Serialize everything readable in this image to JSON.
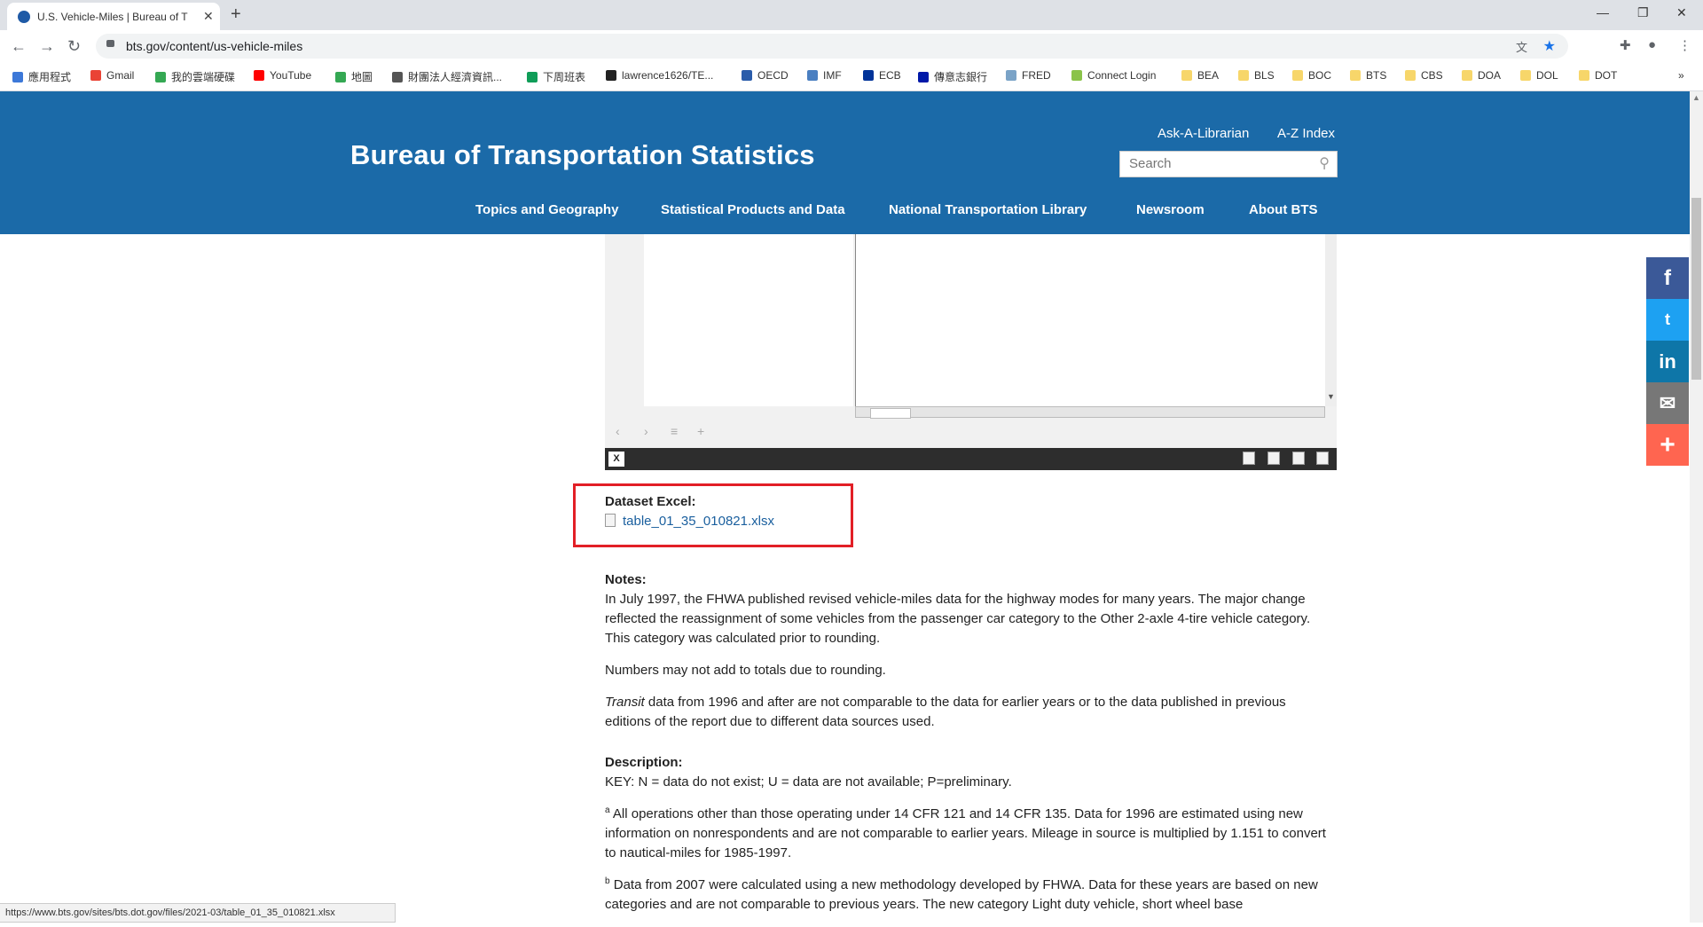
{
  "browser": {
    "tab_title": "U.S. Vehicle-Miles | Bureau of T",
    "url": "bts.gov/content/us-vehicle-miles",
    "bookmarks": [
      "應用程式",
      "Gmail",
      "我的雲端硬碟",
      "YouTube",
      "地圖",
      "財團法人經濟資訊...",
      "下周班表",
      "lawrence1626/TE...",
      "OECD",
      "IMF",
      "ECB",
      "傳意志銀行",
      "FRED",
      "Connect Login",
      "BEA",
      "BLS",
      "BOC",
      "BTS",
      "CBS",
      "DOA",
      "DOL",
      "DOT"
    ],
    "status_url": "https://www.bts.gov/sites/bts.dot.gov/files/2021-03/table_01_35_010821.xlsx"
  },
  "site": {
    "title": "Bureau of Transportation Statistics",
    "ask_librarian": "Ask-A-Librarian",
    "az_index": "A-Z Index",
    "search_placeholder": "Search",
    "nav": [
      "Topics and Geography",
      "Statistical Products and Data",
      "National Transportation Library",
      "Newsroom",
      "About BTS"
    ]
  },
  "dataset": {
    "label": "Dataset Excel:",
    "file": "table_01_35_010821.xlsx"
  },
  "notes": {
    "heading": "Notes:",
    "p1": "In July 1997, the FHWA published revised vehicle-miles data for the highway modes for many years. The major change reflected the reassignment of some vehicles from the passenger car category to the Other 2-axle 4-tire vehicle category. This category was calculated prior to rounding.",
    "p2": "Numbers may not add to totals due to rounding.",
    "p3_italic": "Transit",
    "p3_rest": " data from 1996 and after are not comparable to the data for earlier years or to the data published in previous editions of the report due to different data sources used."
  },
  "description": {
    "heading": "Description:",
    "key": "KEY: N = data do not exist; U = data are not available; P=preliminary.",
    "a_sup": "a",
    "a_text": " All operations other than those operating under 14 CFR 121 and 14 CFR 135. Data for 1996 are estimated using new information on nonrespondents and are not comparable to earlier years. Mileage in source is multiplied by 1.151 to convert to nautical-miles for 1985-1997.",
    "b_sup": "b",
    "b_text": " Data from 2007 were calculated using a new methodology developed by FHWA. Data for these years are based on new categories and are not comparable to previous years. The new category Light duty vehicle, short wheel base"
  },
  "share": [
    "f",
    "t",
    "in",
    "✉",
    "+"
  ],
  "colors": {
    "header_blue": "#1b6aa8",
    "highlight_red": "#e21f26",
    "facebook": "#3b5998",
    "twitter": "#1da1f2",
    "linkedin": "#0e76a8",
    "email": "#777777",
    "more": "#ff6550"
  }
}
